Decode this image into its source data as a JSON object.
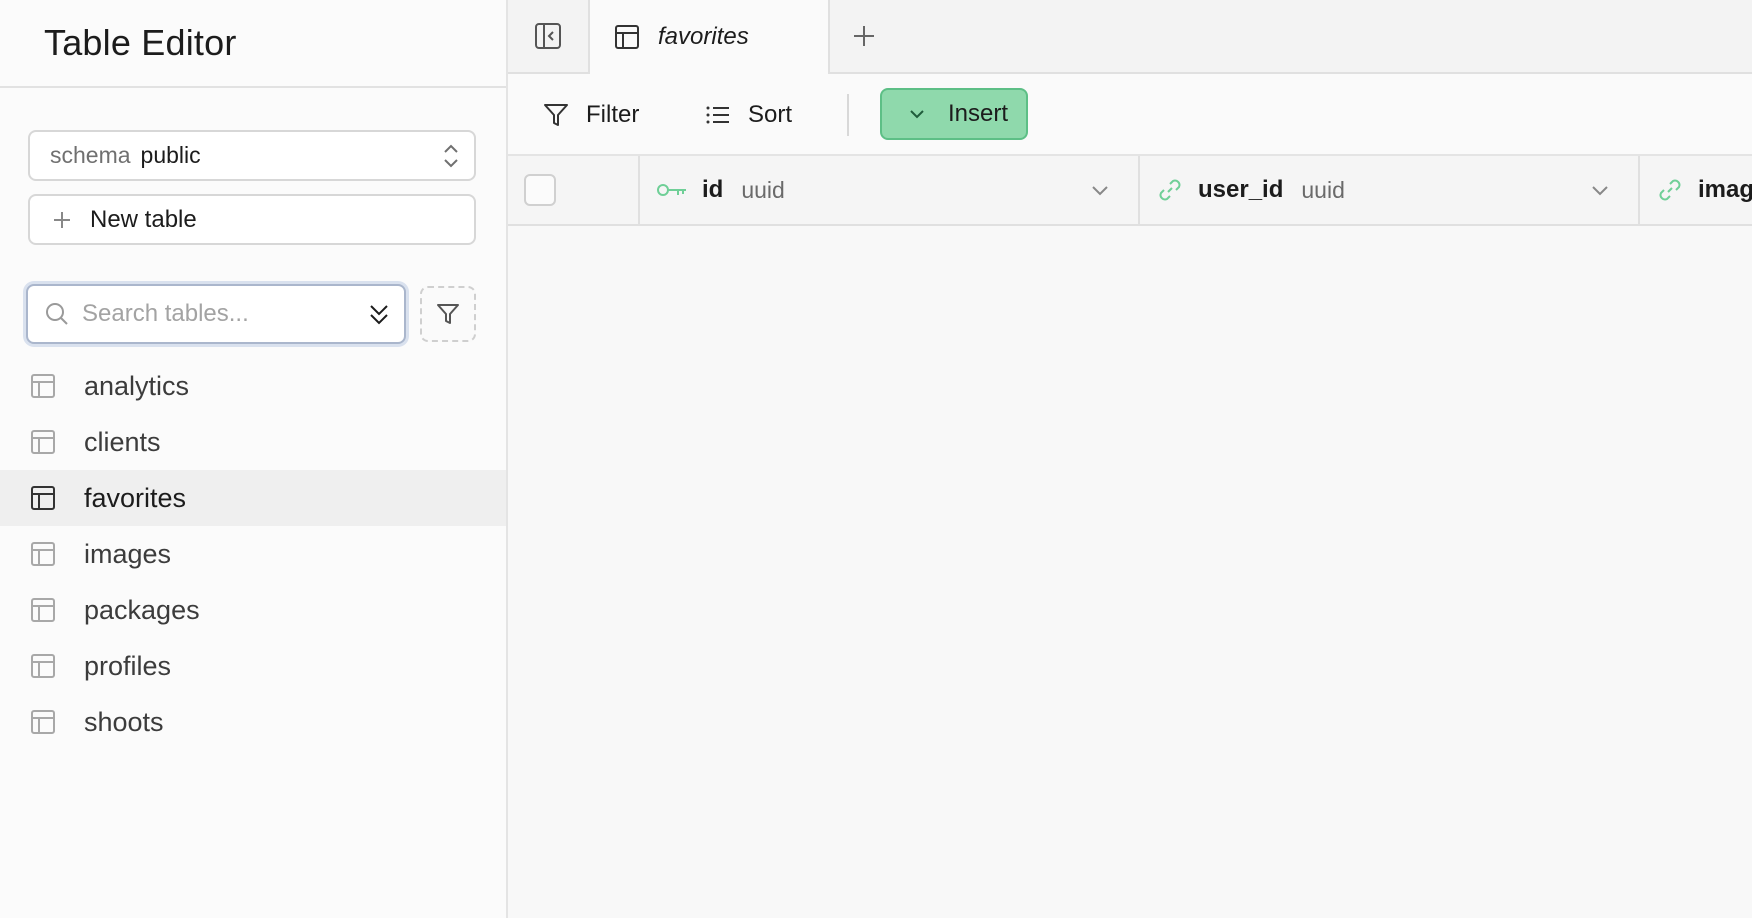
{
  "sidebar": {
    "title": "Table Editor",
    "schema": {
      "label": "schema",
      "value": "public"
    },
    "new_table_label": "New table",
    "search": {
      "placeholder": "Search tables...",
      "value": ""
    },
    "tables": [
      {
        "name": "analytics",
        "active": false
      },
      {
        "name": "clients",
        "active": false
      },
      {
        "name": "favorites",
        "active": true
      },
      {
        "name": "images",
        "active": false
      },
      {
        "name": "packages",
        "active": false
      },
      {
        "name": "profiles",
        "active": false
      },
      {
        "name": "shoots",
        "active": false
      }
    ]
  },
  "tabs": [
    {
      "label": "favorites",
      "active": true
    }
  ],
  "toolbar": {
    "filter_label": "Filter",
    "sort_label": "Sort",
    "insert_label": "Insert"
  },
  "grid": {
    "columns": [
      {
        "name": "id",
        "type": "uuid",
        "icon": "key-icon"
      },
      {
        "name": "user_id",
        "type": "uuid",
        "icon": "link-icon"
      },
      {
        "name": "imag",
        "type": "",
        "icon": "link-icon"
      }
    ]
  },
  "colors": {
    "accent": "#3ecf8e",
    "insert_bg": "#8fd9ac",
    "key_icon": "#6fcf97"
  }
}
